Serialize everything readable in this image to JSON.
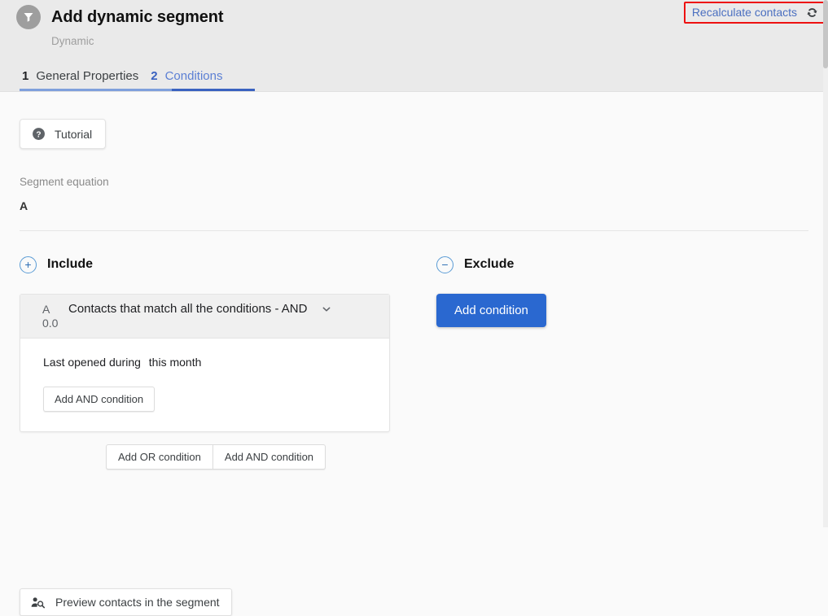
{
  "header": {
    "title": "Add dynamic segment",
    "subtitle": "Dynamic",
    "segment_icon": "funnel-icon",
    "recalculate": {
      "label": "Recalculate contacts",
      "icon": "refresh-sync-icon",
      "highlight_color": "#ee1111"
    },
    "tabs": [
      {
        "num": "1",
        "label": "General Properties",
        "active": false
      },
      {
        "num": "2",
        "label": "Conditions",
        "active": true
      }
    ]
  },
  "toolbar": {
    "tutorial_label": "Tutorial",
    "tutorial_icon": "help-circle-icon"
  },
  "equation": {
    "label": "Segment equation",
    "value": "A"
  },
  "include": {
    "title": "Include",
    "icon": "plus-circle-icon",
    "card": {
      "letter": "A",
      "count": "0.0",
      "match_text": "Contacts that match all the conditions - AND",
      "chevron_icon": "chevron-down-icon",
      "condition": {
        "field": "Last opened",
        "operator": "during",
        "value": "this month"
      },
      "add_and_label": "Add AND condition"
    },
    "group_buttons": [
      "Add OR condition",
      "Add AND condition"
    ]
  },
  "exclude": {
    "title": "Exclude",
    "icon": "minus-circle-icon",
    "add_condition_label": "Add condition",
    "accent_color": "#2a68d0"
  },
  "footer": {
    "preview_label": "Preview contacts in the segment",
    "preview_icon": "person-search-icon"
  }
}
